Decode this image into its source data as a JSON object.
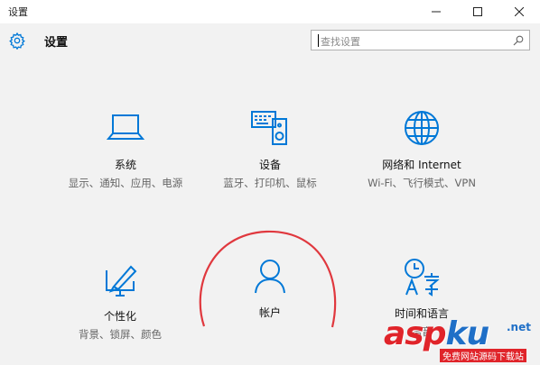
{
  "window": {
    "title": "设置"
  },
  "header": {
    "title": "设置"
  },
  "search": {
    "placeholder": "查找设置"
  },
  "tiles": [
    {
      "name": "系统",
      "desc": "显示、通知、应用、电源",
      "icon": "laptop-icon"
    },
    {
      "name": "设备",
      "desc": "蓝牙、打印机、鼠标",
      "icon": "devices-icon"
    },
    {
      "name": "网络和 Internet",
      "desc": "Wi-Fi、飞行模式、VPN",
      "icon": "globe-icon"
    },
    {
      "name": "个性化",
      "desc": "背景、锁屏、颜色",
      "icon": "personalization-icon"
    },
    {
      "name": "帐户",
      "desc": "",
      "icon": "account-icon"
    },
    {
      "name": "时间和语言",
      "desc": "语音",
      "icon": "time-language-icon"
    }
  ],
  "watermark": {
    "brand_a": "asp",
    "brand_b": "ku",
    "suffix": ".net",
    "tagline": "免费网站源码下载站"
  },
  "colors": {
    "accent": "#0078d7",
    "annotation": "#e0383e"
  }
}
